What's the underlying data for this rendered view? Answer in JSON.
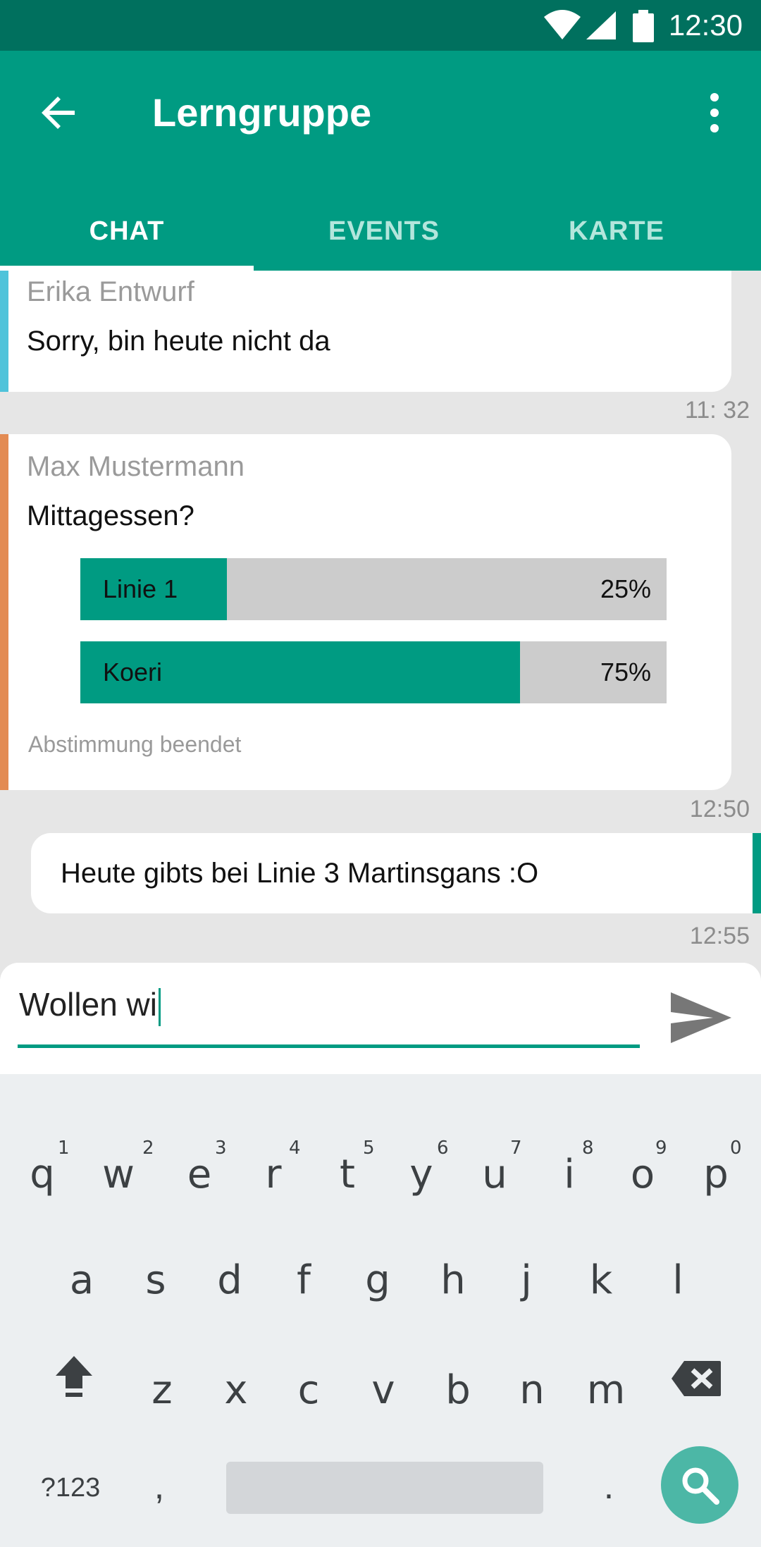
{
  "status_bar": {
    "time": "12:30"
  },
  "app_bar": {
    "title": "Lerngruppe"
  },
  "tabs": [
    {
      "label": "CHAT",
      "active": true
    },
    {
      "label": "EVENTS",
      "active": false
    },
    {
      "label": "KARTE",
      "active": false
    }
  ],
  "messages": [
    {
      "author": "Erika Entwurf",
      "text": "Sorry, bin heute nicht da",
      "time": "11: 32",
      "accent": "#4fc3da"
    },
    {
      "author": "Max Mustermann",
      "text": "Mittagessen?",
      "time": "12:50",
      "accent": "#e38b53",
      "poll": {
        "options": [
          {
            "label": "Linie 1",
            "percent": "25%",
            "fraction": 0.25
          },
          {
            "label": "Koeri",
            "percent": "75%",
            "fraction": 0.75
          }
        ],
        "status": "Abstimmung beendet"
      }
    },
    {
      "text": "Heute gibts bei Linie 3 Martinsgans :O",
      "time": "12:55",
      "accent": "#009b82"
    }
  ],
  "composer": {
    "value": "Wollen wi"
  },
  "keyboard": {
    "row1": [
      "q",
      "w",
      "e",
      "r",
      "t",
      "y",
      "u",
      "i",
      "o",
      "p"
    ],
    "row1_hints": [
      "1",
      "2",
      "3",
      "4",
      "5",
      "6",
      "7",
      "8",
      "9",
      "0"
    ],
    "row2": [
      "a",
      "s",
      "d",
      "f",
      "g",
      "h",
      "j",
      "k",
      "l"
    ],
    "row3": [
      "z",
      "x",
      "c",
      "v",
      "b",
      "n",
      "m"
    ],
    "symbols_label": "?123",
    "comma": ",",
    "period": "."
  },
  "colors": {
    "primary": "#009b82",
    "primary_dark": "#00705e"
  }
}
